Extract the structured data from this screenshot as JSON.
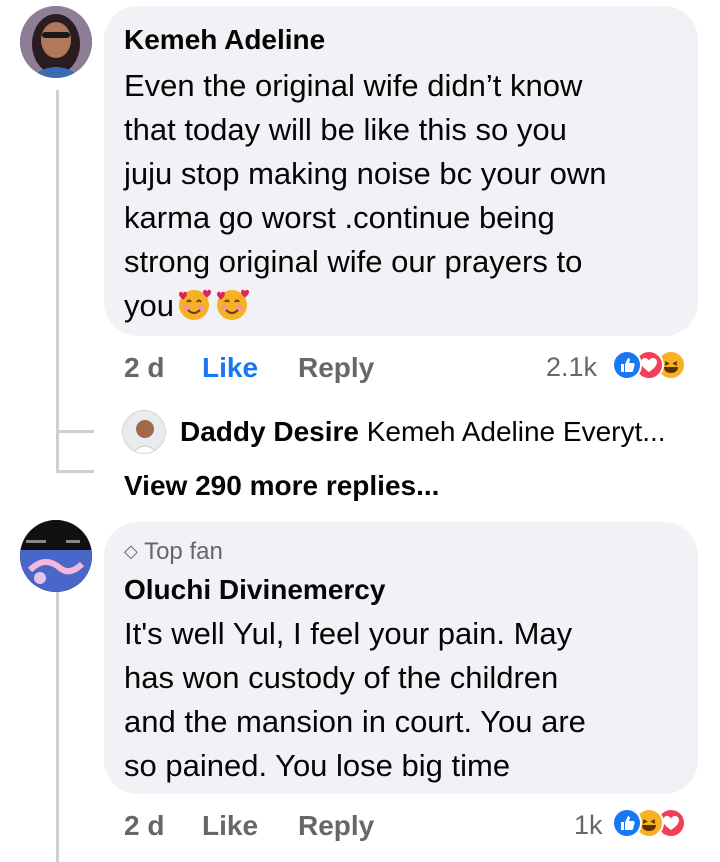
{
  "comments": [
    {
      "author": "Kemeh Adeline",
      "text_lines": [
        "Even the original wife didn’t know",
        "that today will be like this so you",
        "juju stop making noise bc your own",
        "karma go worst .continue being",
        "strong original wife our prayers to",
        "you"
      ],
      "trailing_emojis": [
        "smiling-face-with-hearts",
        "smiling-face-with-hearts"
      ],
      "time": "2 d",
      "like_label": "Like",
      "reply_label": "Reply",
      "reaction_count": "2.1k",
      "reactions": [
        "like",
        "love",
        "haha"
      ]
    },
    {
      "badge": "Top fan",
      "author": "Oluchi Divinemercy",
      "text_lines": [
        "It's well Yul,  I feel your pain. May",
        "has won custody of the children",
        "and the mansion in court.  You are",
        "so pained. You lose big time"
      ],
      "time": "2 d",
      "like_label": "Like",
      "reply_label": "Reply",
      "reaction_count": "1k",
      "reactions": [
        "like",
        "haha",
        "love"
      ]
    }
  ],
  "reply_preview": {
    "author": "Daddy Desire",
    "text": "Kemeh Adeline Everyt..."
  },
  "view_more_label": "View 290 more replies...",
  "colors": {
    "bubble": "#f0f2f5",
    "like_active": "#1877f2",
    "meta": "#65676b",
    "love": "#f33e58",
    "haha": "#f7b125"
  }
}
